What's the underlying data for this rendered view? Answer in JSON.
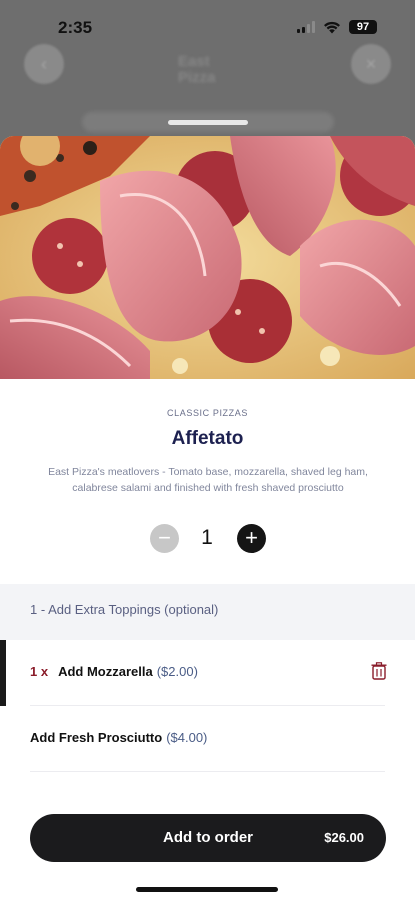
{
  "status": {
    "time": "2:35",
    "battery": "97"
  },
  "background": {
    "logo_line1": "East",
    "logo_line2": "Pizza"
  },
  "product": {
    "category": "CLASSIC PIZZAS",
    "name": "Affetato",
    "description": "East Pizza's meatlovers - Tomato base, mozzarella, shaved leg ham, calabrese salami and finished with fresh shaved prosciutto",
    "quantity": "1",
    "minus_symbol": "−",
    "plus_symbol": "+"
  },
  "options_section": {
    "title": "1 - Add Extra Toppings (optional)",
    "items": [
      {
        "count": "1 x",
        "label": "Add Mozzarella",
        "price": "($2.00)"
      },
      {
        "label": "Add Fresh Prosciutto",
        "price": "($4.00)"
      }
    ]
  },
  "cta": {
    "label": "Add to order",
    "price": "$26.00"
  },
  "icons": {
    "hero": "pizza-photo",
    "remove": "trash-icon",
    "bg_left": "back-icon",
    "bg_right": "close-icon"
  },
  "colors": {
    "title": "#1d2150",
    "cta_bg": "#1b1b1d",
    "count_accent": "#8a1c2a",
    "price_accent": "#4a5c86"
  }
}
